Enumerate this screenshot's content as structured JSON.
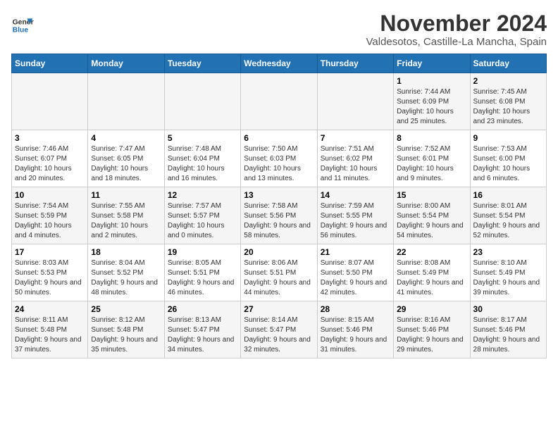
{
  "logo": {
    "line1": "General",
    "line2": "Blue"
  },
  "title": "November 2024",
  "subtitle": "Valdesotos, Castille-La Mancha, Spain",
  "weekdays": [
    "Sunday",
    "Monday",
    "Tuesday",
    "Wednesday",
    "Thursday",
    "Friday",
    "Saturday"
  ],
  "weeks": [
    [
      {
        "day": "",
        "info": ""
      },
      {
        "day": "",
        "info": ""
      },
      {
        "day": "",
        "info": ""
      },
      {
        "day": "",
        "info": ""
      },
      {
        "day": "",
        "info": ""
      },
      {
        "day": "1",
        "info": "Sunrise: 7:44 AM\nSunset: 6:09 PM\nDaylight: 10 hours and 25 minutes."
      },
      {
        "day": "2",
        "info": "Sunrise: 7:45 AM\nSunset: 6:08 PM\nDaylight: 10 hours and 23 minutes."
      }
    ],
    [
      {
        "day": "3",
        "info": "Sunrise: 7:46 AM\nSunset: 6:07 PM\nDaylight: 10 hours and 20 minutes."
      },
      {
        "day": "4",
        "info": "Sunrise: 7:47 AM\nSunset: 6:05 PM\nDaylight: 10 hours and 18 minutes."
      },
      {
        "day": "5",
        "info": "Sunrise: 7:48 AM\nSunset: 6:04 PM\nDaylight: 10 hours and 16 minutes."
      },
      {
        "day": "6",
        "info": "Sunrise: 7:50 AM\nSunset: 6:03 PM\nDaylight: 10 hours and 13 minutes."
      },
      {
        "day": "7",
        "info": "Sunrise: 7:51 AM\nSunset: 6:02 PM\nDaylight: 10 hours and 11 minutes."
      },
      {
        "day": "8",
        "info": "Sunrise: 7:52 AM\nSunset: 6:01 PM\nDaylight: 10 hours and 9 minutes."
      },
      {
        "day": "9",
        "info": "Sunrise: 7:53 AM\nSunset: 6:00 PM\nDaylight: 10 hours and 6 minutes."
      }
    ],
    [
      {
        "day": "10",
        "info": "Sunrise: 7:54 AM\nSunset: 5:59 PM\nDaylight: 10 hours and 4 minutes."
      },
      {
        "day": "11",
        "info": "Sunrise: 7:55 AM\nSunset: 5:58 PM\nDaylight: 10 hours and 2 minutes."
      },
      {
        "day": "12",
        "info": "Sunrise: 7:57 AM\nSunset: 5:57 PM\nDaylight: 10 hours and 0 minutes."
      },
      {
        "day": "13",
        "info": "Sunrise: 7:58 AM\nSunset: 5:56 PM\nDaylight: 9 hours and 58 minutes."
      },
      {
        "day": "14",
        "info": "Sunrise: 7:59 AM\nSunset: 5:55 PM\nDaylight: 9 hours and 56 minutes."
      },
      {
        "day": "15",
        "info": "Sunrise: 8:00 AM\nSunset: 5:54 PM\nDaylight: 9 hours and 54 minutes."
      },
      {
        "day": "16",
        "info": "Sunrise: 8:01 AM\nSunset: 5:54 PM\nDaylight: 9 hours and 52 minutes."
      }
    ],
    [
      {
        "day": "17",
        "info": "Sunrise: 8:03 AM\nSunset: 5:53 PM\nDaylight: 9 hours and 50 minutes."
      },
      {
        "day": "18",
        "info": "Sunrise: 8:04 AM\nSunset: 5:52 PM\nDaylight: 9 hours and 48 minutes."
      },
      {
        "day": "19",
        "info": "Sunrise: 8:05 AM\nSunset: 5:51 PM\nDaylight: 9 hours and 46 minutes."
      },
      {
        "day": "20",
        "info": "Sunrise: 8:06 AM\nSunset: 5:51 PM\nDaylight: 9 hours and 44 minutes."
      },
      {
        "day": "21",
        "info": "Sunrise: 8:07 AM\nSunset: 5:50 PM\nDaylight: 9 hours and 42 minutes."
      },
      {
        "day": "22",
        "info": "Sunrise: 8:08 AM\nSunset: 5:49 PM\nDaylight: 9 hours and 41 minutes."
      },
      {
        "day": "23",
        "info": "Sunrise: 8:10 AM\nSunset: 5:49 PM\nDaylight: 9 hours and 39 minutes."
      }
    ],
    [
      {
        "day": "24",
        "info": "Sunrise: 8:11 AM\nSunset: 5:48 PM\nDaylight: 9 hours and 37 minutes."
      },
      {
        "day": "25",
        "info": "Sunrise: 8:12 AM\nSunset: 5:48 PM\nDaylight: 9 hours and 35 minutes."
      },
      {
        "day": "26",
        "info": "Sunrise: 8:13 AM\nSunset: 5:47 PM\nDaylight: 9 hours and 34 minutes."
      },
      {
        "day": "27",
        "info": "Sunrise: 8:14 AM\nSunset: 5:47 PM\nDaylight: 9 hours and 32 minutes."
      },
      {
        "day": "28",
        "info": "Sunrise: 8:15 AM\nSunset: 5:46 PM\nDaylight: 9 hours and 31 minutes."
      },
      {
        "day": "29",
        "info": "Sunrise: 8:16 AM\nSunset: 5:46 PM\nDaylight: 9 hours and 29 minutes."
      },
      {
        "day": "30",
        "info": "Sunrise: 8:17 AM\nSunset: 5:46 PM\nDaylight: 9 hours and 28 minutes."
      }
    ]
  ]
}
